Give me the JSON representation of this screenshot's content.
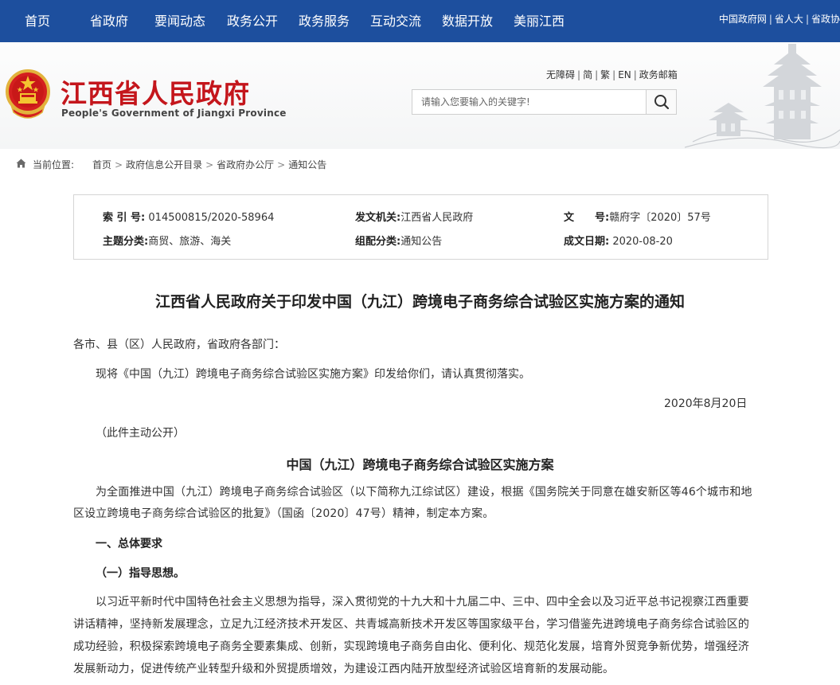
{
  "nav": {
    "items": [
      "首页",
      "省政府",
      "要闻动态",
      "政务公开",
      "政务服务",
      "互动交流",
      "数据开放",
      "美丽江西"
    ],
    "top_links": [
      "中国政府网",
      "省人大",
      "省政协"
    ]
  },
  "header": {
    "title": "江西省人民政府",
    "subtitle": "People's Government of Jiangxi Province",
    "util_links": [
      "无障碍",
      "简",
      "繁",
      "EN",
      "政务邮箱"
    ],
    "search_placeholder": "请输入您要输入的关键字!"
  },
  "breadcrumb": {
    "label": "当前位置:",
    "items": [
      "首页",
      "政府信息公开目录",
      "省政府办公厅",
      "通知公告"
    ]
  },
  "meta": {
    "index_label": "索 引 号:",
    "index_value": "014500815/2020-58964",
    "issuer_label": "发文机关:",
    "issuer_value": "江西省人民政府",
    "doc_label": "文　　号:",
    "doc_value": "赣府字〔2020〕57号",
    "topic_label": "主题分类:",
    "topic_value": "商贸、旅游、海关",
    "org_label": "组配分类:",
    "org_value": "通知公告",
    "date_label": "成文日期:",
    "date_value": "2020-08-20"
  },
  "article": {
    "title": "江西省人民政府关于印发中国（九江）跨境电子商务综合试验区实施方案的通知",
    "salutation": "各市、县（区）人民政府，省政府各部门：",
    "intro": "现将《中国（九江）跨境电子商务综合试验区实施方案》印发给你们，请认真贯彻落实。",
    "date": "2020年8月20日",
    "disclosure": "（此件主动公开）",
    "plan_title": "中国（九江）跨境电子商务综合试验区实施方案",
    "plan_intro_1": "为全面推进中国（九江）跨境电子商务综合试验区（以下简称九江综试区）建设，根据《国务院关于同意在雄安新区等46个城市和地",
    "plan_intro_2": "区设立跨境电子商务综合试验区的批复》（国函〔2020〕47号）精神，制定本方案。",
    "section_1": "一、总体要求",
    "section_1_1": "（一）指导思想。",
    "body_1": "以习近平新时代中国特色社会主义思想为指导，深入贯彻党的十九大和十九届二中、三中、四中全会以及习近平总书记视察江西重要",
    "body_2": "讲话精神，坚持新发展理念，立足九江经济技术开发区、共青城高新技术开发区等国家级平台，学习借鉴先进跨境电子商务综合试验区的",
    "body_3": "成功经验，积极探索跨境电子商务全要素集成、创新，实现跨境电子商务自由化、便利化、规范化发展，培育外贸竞争新优势，增强经济",
    "body_4": "发展新动力，促进传统产业转型升级和外贸提质增效，为建设江西内陆开放型经济试验区培育新的发展动能。"
  },
  "colors": {
    "nav_bg": "#1d4f9e",
    "brand_red": "#c4161c"
  }
}
